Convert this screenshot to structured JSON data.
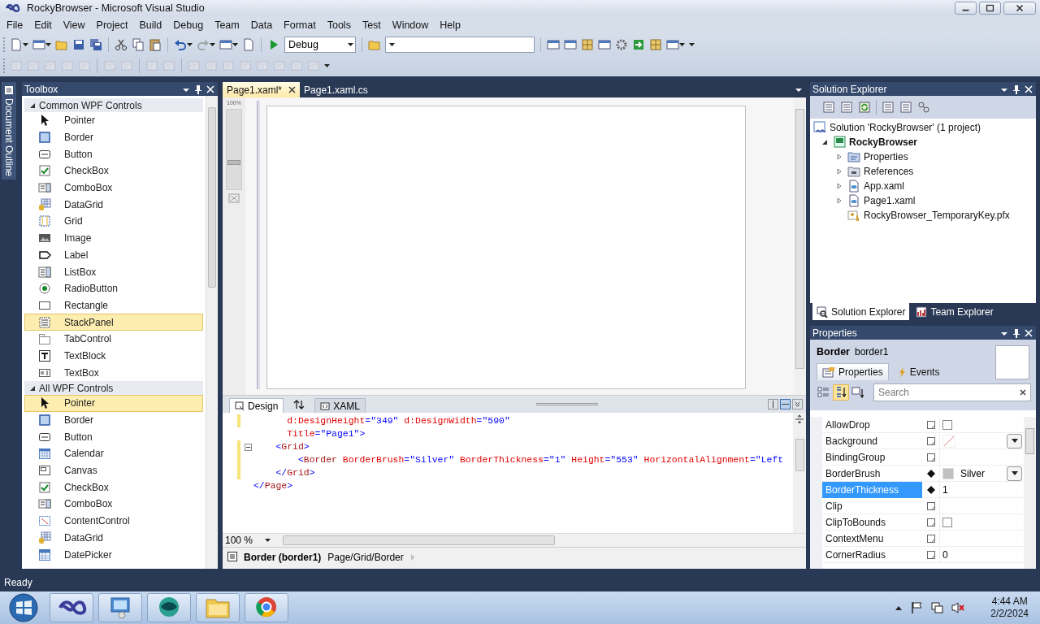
{
  "window": {
    "title": "RockyBrowser - Microsoft Visual Studio"
  },
  "menu": [
    {
      "label": "File"
    },
    {
      "label": "Edit"
    },
    {
      "label": "View"
    },
    {
      "label": "Project"
    },
    {
      "label": "Build"
    },
    {
      "label": "Debug"
    },
    {
      "label": "Team"
    },
    {
      "label": "Data"
    },
    {
      "label": "Format"
    },
    {
      "label": "Tools"
    },
    {
      "label": "Test"
    },
    {
      "label": "Window"
    },
    {
      "label": "Help"
    }
  ],
  "toolbar": {
    "configuration": "Debug"
  },
  "document_outline": {
    "label": "Document Outline"
  },
  "toolbox": {
    "title": "Toolbox",
    "groups": [
      {
        "label": "Common WPF Controls",
        "expanded": true,
        "items": [
          {
            "label": "Pointer",
            "kind": "pointer",
            "selected": false
          },
          {
            "label": "Border",
            "kind": "border",
            "selected": false
          },
          {
            "label": "Button",
            "kind": "button",
            "selected": false
          },
          {
            "label": "CheckBox",
            "kind": "checkbox",
            "selected": false
          },
          {
            "label": "ComboBox",
            "kind": "combobox",
            "selected": false
          },
          {
            "label": "DataGrid",
            "kind": "datagrid",
            "selected": false
          },
          {
            "label": "Grid",
            "kind": "grid",
            "selected": false
          },
          {
            "label": "Image",
            "kind": "image",
            "selected": false
          },
          {
            "label": "Label",
            "kind": "label",
            "selected": false
          },
          {
            "label": "ListBox",
            "kind": "listbox",
            "selected": false
          },
          {
            "label": "RadioButton",
            "kind": "radio",
            "selected": false
          },
          {
            "label": "Rectangle",
            "kind": "rectangle",
            "selected": false
          },
          {
            "label": "StackPanel",
            "kind": "stackpanel",
            "selected": true
          },
          {
            "label": "TabControl",
            "kind": "tabcontrol",
            "selected": false
          },
          {
            "label": "TextBlock",
            "kind": "textblock",
            "selected": false
          },
          {
            "label": "TextBox",
            "kind": "textbox",
            "selected": false
          }
        ]
      },
      {
        "label": "All WPF Controls",
        "expanded": true,
        "items": [
          {
            "label": "Pointer",
            "kind": "pointer",
            "selected": true
          },
          {
            "label": "Border",
            "kind": "border",
            "selected": false
          },
          {
            "label": "Button",
            "kind": "button",
            "selected": false
          },
          {
            "label": "Calendar",
            "kind": "calendar",
            "selected": false
          },
          {
            "label": "Canvas",
            "kind": "canvas",
            "selected": false
          },
          {
            "label": "CheckBox",
            "kind": "checkbox",
            "selected": false
          },
          {
            "label": "ComboBox",
            "kind": "combobox",
            "selected": false
          },
          {
            "label": "ContentControl",
            "kind": "contentcontrol",
            "selected": false
          },
          {
            "label": "DataGrid",
            "kind": "datagrid",
            "selected": false
          },
          {
            "label": "DatePicker",
            "kind": "datepicker",
            "selected": false
          }
        ]
      }
    ]
  },
  "editor": {
    "tabs": [
      {
        "label": "Page1.xaml*",
        "selected": true
      },
      {
        "label": "Page1.xaml.cs",
        "selected": false
      }
    ],
    "designer": {
      "zoom_label": "100%"
    },
    "views": [
      {
        "label": "Design",
        "selected": true
      },
      {
        "label": "XAML",
        "selected": false
      }
    ],
    "layout_buttons": [
      {
        "kind": "vertical",
        "selected": false
      },
      {
        "kind": "horizontal",
        "selected": true
      },
      {
        "kind": "collapse",
        "selected": false
      }
    ],
    "code_lines": [
      {
        "changed": true,
        "fold": false,
        "tokens": [
          {
            "kind": "attr",
            "text": "      d:DesignHeight"
          },
          {
            "kind": "punct",
            "text": "="
          },
          {
            "kind": "val",
            "text": "\"349\""
          },
          {
            "kind": "attr",
            "text": " d:DesignWidth"
          },
          {
            "kind": "punct",
            "text": "="
          },
          {
            "kind": "val",
            "text": "\"590\""
          }
        ]
      },
      {
        "changed": false,
        "fold": false,
        "tokens": [
          {
            "kind": "attr",
            "text": "      Title"
          },
          {
            "kind": "punct",
            "text": "="
          },
          {
            "kind": "val",
            "text": "\"Page1\""
          },
          {
            "kind": "punct",
            "text": ">"
          }
        ]
      },
      {
        "changed": true,
        "fold": true,
        "tokens": [
          {
            "kind": "punct",
            "text": "    <"
          },
          {
            "kind": "tag",
            "text": "Grid"
          },
          {
            "kind": "punct",
            "text": ">"
          }
        ]
      },
      {
        "changed": true,
        "fold": false,
        "tokens": [
          {
            "kind": "punct",
            "text": "        <"
          },
          {
            "kind": "tag",
            "text": "Border"
          },
          {
            "kind": "attr",
            "text": " BorderBrush"
          },
          {
            "kind": "punct",
            "text": "="
          },
          {
            "kind": "val",
            "text": "\"Silver\""
          },
          {
            "kind": "attr",
            "text": " BorderThickness"
          },
          {
            "kind": "punct",
            "text": "="
          },
          {
            "kind": "val",
            "text": "\"1\""
          },
          {
            "kind": "attr",
            "text": " Height"
          },
          {
            "kind": "punct",
            "text": "="
          },
          {
            "kind": "val",
            "text": "\"553\""
          },
          {
            "kind": "attr",
            "text": " HorizontalAlignment"
          },
          {
            "kind": "punct",
            "text": "="
          },
          {
            "kind": "val",
            "text": "\"Left"
          }
        ]
      },
      {
        "changed": true,
        "fold": false,
        "tokens": [
          {
            "kind": "punct",
            "text": "    </"
          },
          {
            "kind": "tag",
            "text": "Grid"
          },
          {
            "kind": "punct",
            "text": ">"
          }
        ]
      },
      {
        "changed": false,
        "fold": false,
        "tokens": [
          {
            "kind": "punct",
            "text": "</"
          },
          {
            "kind": "tag",
            "text": "Page"
          },
          {
            "kind": "punct",
            "text": ">"
          }
        ]
      }
    ],
    "zoom": "100 %",
    "breadcrumb": {
      "element": "Border (border1)",
      "path": "Page/Grid/Border"
    }
  },
  "solution_explorer": {
    "title": "Solution Explorer",
    "tree": [
      {
        "label": "Solution 'RockyBrowser' (1 project)",
        "kind": "solution",
        "expandable": false,
        "children": [
          {
            "label": "RockyBrowser",
            "kind": "project",
            "expandable": true,
            "expanded": true,
            "children": [
              {
                "label": "Properties",
                "kind": "properties",
                "expandable": true,
                "expanded": false
              },
              {
                "label": "References",
                "kind": "references",
                "expandable": true,
                "expanded": false
              },
              {
                "label": "App.xaml",
                "kind": "xaml",
                "expandable": true,
                "expanded": false
              },
              {
                "label": "Page1.xaml",
                "kind": "xaml",
                "expandable": true,
                "expanded": false
              },
              {
                "label": "RockyBrowser_TemporaryKey.pfx",
                "kind": "key",
                "expandable": false
              }
            ]
          }
        ]
      }
    ],
    "tabs": [
      {
        "label": "Solution Explorer",
        "kind": "solution",
        "selected": true
      },
      {
        "label": "Team Explorer",
        "kind": "team",
        "selected": false
      }
    ]
  },
  "properties": {
    "title": "Properties",
    "type": "Border",
    "name": "border1",
    "tabs": [
      {
        "label": "Properties",
        "kind": "properties",
        "selected": true
      },
      {
        "label": "Events",
        "kind": "events",
        "selected": false
      }
    ],
    "view_modes": [
      {
        "kind": "categorized",
        "selected": false
      },
      {
        "kind": "alphabetical",
        "selected": true
      }
    ],
    "search": {
      "placeholder": "Search"
    },
    "rows": [
      {
        "name": "AllowDrop",
        "local_value": false,
        "selected": false,
        "kind": "checkbox",
        "checked": false
      },
      {
        "name": "Background",
        "local_value": false,
        "selected": false,
        "kind": "brush"
      },
      {
        "name": "BindingGroup",
        "local_value": false,
        "selected": false,
        "kind": "empty"
      },
      {
        "name": "BorderBrush",
        "local_value": true,
        "selected": false,
        "kind": "brush",
        "value": "Silver",
        "color": "#c0c0c0"
      },
      {
        "name": "BorderThickness",
        "local_value": true,
        "selected": true,
        "kind": "text",
        "value": "1"
      },
      {
        "name": "Clip",
        "local_value": false,
        "selected": false,
        "kind": "empty"
      },
      {
        "name": "ClipToBounds",
        "local_value": false,
        "selected": false,
        "kind": "checkbox",
        "checked": false
      },
      {
        "name": "ContextMenu",
        "local_value": false,
        "selected": false,
        "kind": "empty"
      },
      {
        "name": "CornerRadius",
        "local_value": false,
        "selected": false,
        "kind": "text",
        "value": "0"
      }
    ]
  },
  "status_bar": {
    "text": "Ready"
  },
  "taskbar": {
    "apps": [
      {
        "kind": "vs"
      },
      {
        "kind": "monitor"
      },
      {
        "kind": "globe"
      },
      {
        "kind": "folder"
      },
      {
        "kind": "browser"
      }
    ],
    "clock": {
      "time": "4:44 AM",
      "date": "2/2/2024"
    }
  }
}
